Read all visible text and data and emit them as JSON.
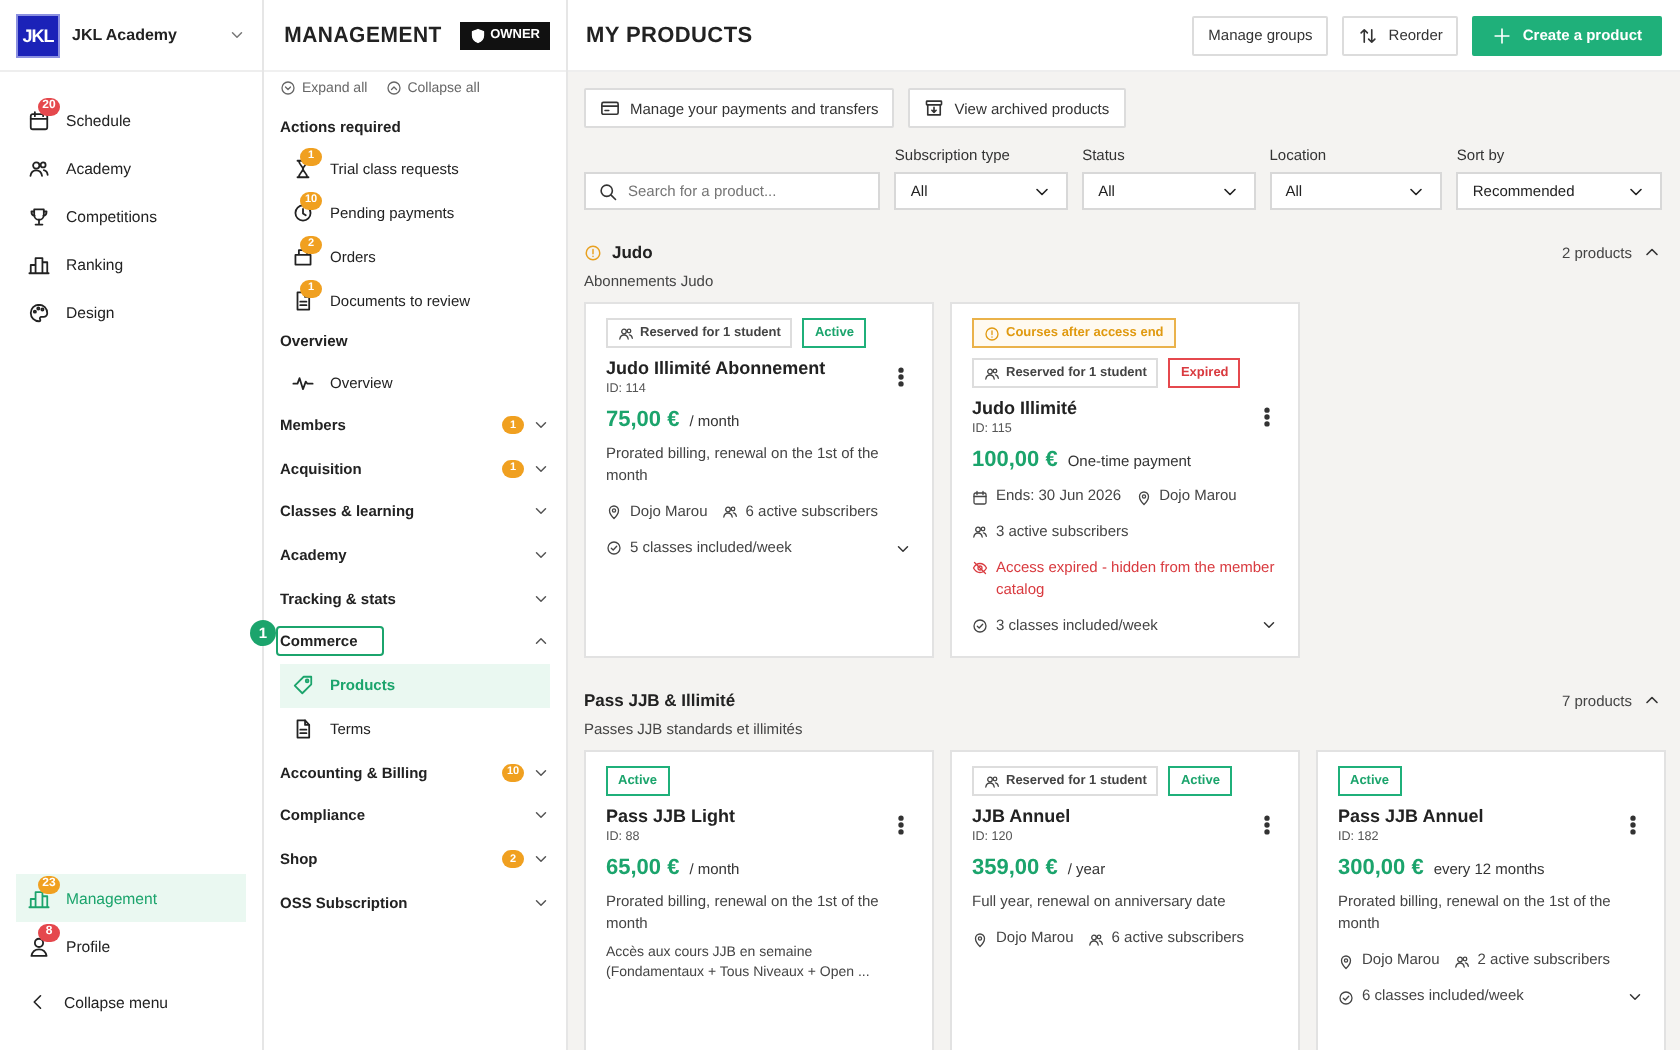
{
  "rail": {
    "logo": "JKL",
    "academy": "JKL Academy",
    "items": [
      {
        "label": "Schedule",
        "selected": false,
        "badge": {
          "text": "20",
          "color": "#e5484d"
        }
      },
      {
        "label": "Academy",
        "selected": false
      },
      {
        "label": "Competitions",
        "selected": false
      },
      {
        "label": "Ranking",
        "selected": false
      },
      {
        "label": "Design",
        "selected": false
      }
    ],
    "bottom_items": [
      {
        "label": "Management",
        "selected": true,
        "badge": {
          "text": "23",
          "color": "#f0a020"
        }
      },
      {
        "label": "Profile",
        "selected": false,
        "badge": {
          "text": "8",
          "color": "#e5484d"
        }
      }
    ],
    "collapse": "Collapse menu"
  },
  "panel": {
    "title": "MANAGEMENT",
    "role": "OWNER",
    "expand_all": "Expand all",
    "collapse_all": "Collapse all",
    "sections": [
      {
        "kind": "heading",
        "label": "Actions required",
        "items": [
          {
            "label": "Trial class requests",
            "badge": "1",
            "selected": false
          },
          {
            "label": "Pending payments",
            "badge": "10",
            "selected": false
          },
          {
            "label": "Orders",
            "badge": "2",
            "selected": false
          },
          {
            "label": "Documents to review",
            "badge": "1",
            "selected": false
          }
        ]
      },
      {
        "kind": "heading",
        "label": "Overview",
        "items": [
          {
            "label": "Overview",
            "selected": false
          }
        ]
      },
      {
        "kind": "accordion",
        "label": "Members",
        "badge": "1",
        "expanded": false
      },
      {
        "kind": "accordion",
        "label": "Acquisition",
        "badge": "1",
        "expanded": false
      },
      {
        "kind": "accordion",
        "label": "Classes & learning",
        "expanded": false
      },
      {
        "kind": "accordion",
        "label": "Academy",
        "expanded": false
      },
      {
        "kind": "accordion",
        "label": "Tracking & stats",
        "expanded": false
      },
      {
        "kind": "accordion",
        "label": "Commerce",
        "expanded": true,
        "step": "1",
        "items": [
          {
            "label": "Products",
            "selected": true
          },
          {
            "label": "Terms",
            "selected": false
          }
        ]
      },
      {
        "kind": "accordion",
        "label": "Accounting & Billing",
        "badge": "10",
        "expanded": false
      },
      {
        "kind": "accordion",
        "label": "Compliance",
        "expanded": false
      },
      {
        "kind": "accordion",
        "label": "Shop",
        "badge": "2",
        "expanded": false
      },
      {
        "kind": "accordion",
        "label": "OSS Subscription",
        "expanded": false
      }
    ]
  },
  "main": {
    "title": "MY PRODUCTS",
    "actions": [
      {
        "label": "Manage groups",
        "kind": "outline"
      },
      {
        "label": "Reorder",
        "kind": "reorder"
      },
      {
        "label": "Create a product",
        "kind": "primary"
      }
    ],
    "links": [
      "Manage your payments and transfers",
      "View archived products"
    ],
    "search": {
      "placeholder": "Search for a product..."
    },
    "filters": [
      {
        "label": "Subscription type",
        "value": "All"
      },
      {
        "label": "Status",
        "value": "All"
      },
      {
        "label": "Location",
        "value": "All"
      },
      {
        "label": "Sort by",
        "value": "Recommended"
      }
    ],
    "groups": [
      {
        "title": "Judo",
        "warning": true,
        "subtitle": "Abonnements Judo",
        "count": "2 products",
        "expanded": true,
        "products": [
          {
            "tags": [
              {
                "kind": "reserved",
                "text": "Reserved for 1 student"
              },
              {
                "kind": "active",
                "text": "Active"
              }
            ],
            "name": "Judo Illimité Abonnement",
            "id": "ID: 114",
            "price": "75,00 €",
            "period": "/ month",
            "description": "Prorated billing, renewal on the 1st of the month",
            "meta": [
              [
                {
                  "kind": "location",
                  "text": "Dojo Marou"
                },
                {
                  "kind": "subscribers",
                  "text": "6 active subscribers"
                }
              ],
              [
                {
                  "kind": "classes",
                  "text": "5 classes included/week",
                  "expanded": false
                }
              ]
            ]
          },
          {
            "tags": [
              {
                "kind": "warning",
                "text": "Courses after access end"
              },
              {
                "kind": "reserved",
                "text": "Reserved for 1 student"
              },
              {
                "kind": "expired",
                "text": "Expired"
              }
            ],
            "name": "Judo Illimité",
            "id": "ID: 115",
            "price": "100,00 €",
            "period": "One-time payment",
            "meta": [
              [
                {
                  "kind": "ends",
                  "text": "Ends: 30 Jun 2026"
                },
                {
                  "kind": "location",
                  "text": "Dojo Marou"
                }
              ],
              [
                {
                  "kind": "subscribers",
                  "text": "3 active subscribers"
                }
              ],
              [
                {
                  "kind": "hidden",
                  "text": "Access expired - hidden from the member catalog"
                }
              ],
              [
                {
                  "kind": "classes",
                  "text": "3 classes included/week",
                  "expanded": false
                }
              ]
            ]
          }
        ]
      },
      {
        "title": "Pass JJB & Illimité",
        "warning": false,
        "subtitle": "Passes JJB standards et illimités",
        "count": "7 products",
        "expanded": true,
        "products": [
          {
            "tags": [
              {
                "kind": "active",
                "text": "Active"
              }
            ],
            "name": "Pass JJB Light",
            "id": "ID: 88",
            "price": "65,00 €",
            "period": "/ month",
            "description": "Prorated billing, renewal on the 1st of the month",
            "note": "Accès aux cours JJB en semaine (Fondamentaux + Tous Niveaux + Open ..."
          },
          {
            "tags": [
              {
                "kind": "reserved",
                "text": "Reserved for 1 student"
              },
              {
                "kind": "active",
                "text": "Active"
              }
            ],
            "name": "JJB Annuel",
            "id": "ID: 120",
            "price": "359,00 €",
            "period": "/ year",
            "description": "Full year, renewal on anniversary date",
            "meta": [
              [
                {
                  "kind": "location",
                  "text": "Dojo Marou"
                },
                {
                  "kind": "subscribers",
                  "text": "6 active subscribers"
                }
              ]
            ]
          },
          {
            "tags": [
              {
                "kind": "active",
                "text": "Active"
              }
            ],
            "name": "Pass JJB Annuel",
            "id": "ID: 182",
            "price": "300,00 €",
            "period": "every 12 months",
            "description": "Prorated billing, renewal on the 1st of the month",
            "meta": [
              [
                {
                  "kind": "location",
                  "text": "Dojo Marou"
                },
                {
                  "kind": "subscribers",
                  "text": "2 active subscribers"
                }
              ],
              [
                {
                  "kind": "classes",
                  "text": "6 classes included/week",
                  "expanded": false
                }
              ]
            ]
          }
        ]
      }
    ]
  }
}
